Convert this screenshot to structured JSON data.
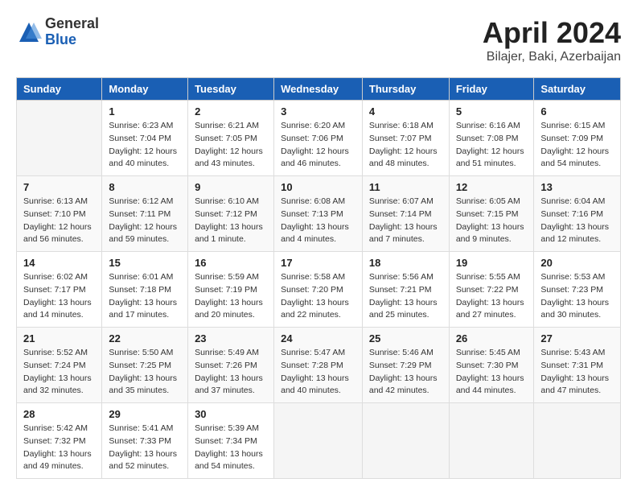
{
  "header": {
    "logo_general": "General",
    "logo_blue": "Blue",
    "title": "April 2024",
    "location": "Bilajer, Baki, Azerbaijan"
  },
  "calendar": {
    "weekdays": [
      "Sunday",
      "Monday",
      "Tuesday",
      "Wednesday",
      "Thursday",
      "Friday",
      "Saturday"
    ],
    "weeks": [
      [
        {
          "day": "",
          "sunrise": "",
          "sunset": "",
          "daylight": ""
        },
        {
          "day": "1",
          "sunrise": "Sunrise: 6:23 AM",
          "sunset": "Sunset: 7:04 PM",
          "daylight": "Daylight: 12 hours and 40 minutes."
        },
        {
          "day": "2",
          "sunrise": "Sunrise: 6:21 AM",
          "sunset": "Sunset: 7:05 PM",
          "daylight": "Daylight: 12 hours and 43 minutes."
        },
        {
          "day": "3",
          "sunrise": "Sunrise: 6:20 AM",
          "sunset": "Sunset: 7:06 PM",
          "daylight": "Daylight: 12 hours and 46 minutes."
        },
        {
          "day": "4",
          "sunrise": "Sunrise: 6:18 AM",
          "sunset": "Sunset: 7:07 PM",
          "daylight": "Daylight: 12 hours and 48 minutes."
        },
        {
          "day": "5",
          "sunrise": "Sunrise: 6:16 AM",
          "sunset": "Sunset: 7:08 PM",
          "daylight": "Daylight: 12 hours and 51 minutes."
        },
        {
          "day": "6",
          "sunrise": "Sunrise: 6:15 AM",
          "sunset": "Sunset: 7:09 PM",
          "daylight": "Daylight: 12 hours and 54 minutes."
        }
      ],
      [
        {
          "day": "7",
          "sunrise": "Sunrise: 6:13 AM",
          "sunset": "Sunset: 7:10 PM",
          "daylight": "Daylight: 12 hours and 56 minutes."
        },
        {
          "day": "8",
          "sunrise": "Sunrise: 6:12 AM",
          "sunset": "Sunset: 7:11 PM",
          "daylight": "Daylight: 12 hours and 59 minutes."
        },
        {
          "day": "9",
          "sunrise": "Sunrise: 6:10 AM",
          "sunset": "Sunset: 7:12 PM",
          "daylight": "Daylight: 13 hours and 1 minute."
        },
        {
          "day": "10",
          "sunrise": "Sunrise: 6:08 AM",
          "sunset": "Sunset: 7:13 PM",
          "daylight": "Daylight: 13 hours and 4 minutes."
        },
        {
          "day": "11",
          "sunrise": "Sunrise: 6:07 AM",
          "sunset": "Sunset: 7:14 PM",
          "daylight": "Daylight: 13 hours and 7 minutes."
        },
        {
          "day": "12",
          "sunrise": "Sunrise: 6:05 AM",
          "sunset": "Sunset: 7:15 PM",
          "daylight": "Daylight: 13 hours and 9 minutes."
        },
        {
          "day": "13",
          "sunrise": "Sunrise: 6:04 AM",
          "sunset": "Sunset: 7:16 PM",
          "daylight": "Daylight: 13 hours and 12 minutes."
        }
      ],
      [
        {
          "day": "14",
          "sunrise": "Sunrise: 6:02 AM",
          "sunset": "Sunset: 7:17 PM",
          "daylight": "Daylight: 13 hours and 14 minutes."
        },
        {
          "day": "15",
          "sunrise": "Sunrise: 6:01 AM",
          "sunset": "Sunset: 7:18 PM",
          "daylight": "Daylight: 13 hours and 17 minutes."
        },
        {
          "day": "16",
          "sunrise": "Sunrise: 5:59 AM",
          "sunset": "Sunset: 7:19 PM",
          "daylight": "Daylight: 13 hours and 20 minutes."
        },
        {
          "day": "17",
          "sunrise": "Sunrise: 5:58 AM",
          "sunset": "Sunset: 7:20 PM",
          "daylight": "Daylight: 13 hours and 22 minutes."
        },
        {
          "day": "18",
          "sunrise": "Sunrise: 5:56 AM",
          "sunset": "Sunset: 7:21 PM",
          "daylight": "Daylight: 13 hours and 25 minutes."
        },
        {
          "day": "19",
          "sunrise": "Sunrise: 5:55 AM",
          "sunset": "Sunset: 7:22 PM",
          "daylight": "Daylight: 13 hours and 27 minutes."
        },
        {
          "day": "20",
          "sunrise": "Sunrise: 5:53 AM",
          "sunset": "Sunset: 7:23 PM",
          "daylight": "Daylight: 13 hours and 30 minutes."
        }
      ],
      [
        {
          "day": "21",
          "sunrise": "Sunrise: 5:52 AM",
          "sunset": "Sunset: 7:24 PM",
          "daylight": "Daylight: 13 hours and 32 minutes."
        },
        {
          "day": "22",
          "sunrise": "Sunrise: 5:50 AM",
          "sunset": "Sunset: 7:25 PM",
          "daylight": "Daylight: 13 hours and 35 minutes."
        },
        {
          "day": "23",
          "sunrise": "Sunrise: 5:49 AM",
          "sunset": "Sunset: 7:26 PM",
          "daylight": "Daylight: 13 hours and 37 minutes."
        },
        {
          "day": "24",
          "sunrise": "Sunrise: 5:47 AM",
          "sunset": "Sunset: 7:28 PM",
          "daylight": "Daylight: 13 hours and 40 minutes."
        },
        {
          "day": "25",
          "sunrise": "Sunrise: 5:46 AM",
          "sunset": "Sunset: 7:29 PM",
          "daylight": "Daylight: 13 hours and 42 minutes."
        },
        {
          "day": "26",
          "sunrise": "Sunrise: 5:45 AM",
          "sunset": "Sunset: 7:30 PM",
          "daylight": "Daylight: 13 hours and 44 minutes."
        },
        {
          "day": "27",
          "sunrise": "Sunrise: 5:43 AM",
          "sunset": "Sunset: 7:31 PM",
          "daylight": "Daylight: 13 hours and 47 minutes."
        }
      ],
      [
        {
          "day": "28",
          "sunrise": "Sunrise: 5:42 AM",
          "sunset": "Sunset: 7:32 PM",
          "daylight": "Daylight: 13 hours and 49 minutes."
        },
        {
          "day": "29",
          "sunrise": "Sunrise: 5:41 AM",
          "sunset": "Sunset: 7:33 PM",
          "daylight": "Daylight: 13 hours and 52 minutes."
        },
        {
          "day": "30",
          "sunrise": "Sunrise: 5:39 AM",
          "sunset": "Sunset: 7:34 PM",
          "daylight": "Daylight: 13 hours and 54 minutes."
        },
        {
          "day": "",
          "sunrise": "",
          "sunset": "",
          "daylight": ""
        },
        {
          "day": "",
          "sunrise": "",
          "sunset": "",
          "daylight": ""
        },
        {
          "day": "",
          "sunrise": "",
          "sunset": "",
          "daylight": ""
        },
        {
          "day": "",
          "sunrise": "",
          "sunset": "",
          "daylight": ""
        }
      ]
    ]
  }
}
